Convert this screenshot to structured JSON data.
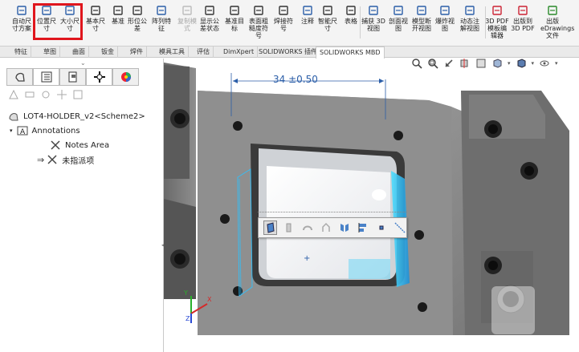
{
  "ribbon": {
    "buttons": [
      {
        "label": "自动尺\n寸方案",
        "icon": "auto-dimension-icon",
        "state": "enabled"
      },
      {
        "label": "位置尺\n寸",
        "icon": "location-dimension-icon",
        "state": "enabled"
      },
      {
        "label": "大小尺\n寸",
        "icon": "size-dimension-icon",
        "state": "enabled"
      },
      {
        "label": "基本尺\n寸",
        "icon": "basic-dimension-icon",
        "state": "enabled"
      },
      {
        "label": "基准",
        "icon": "datum-icon",
        "state": "enabled"
      },
      {
        "label": "形位公\n差",
        "icon": "geometric-tolerance-icon",
        "state": "enabled"
      },
      {
        "label": "阵列特\n征",
        "icon": "pattern-feature-icon",
        "state": "enabled"
      },
      {
        "label": "复制模\n式",
        "icon": "copy-scheme-icon",
        "state": "disabled"
      },
      {
        "label": "显示公\n差状态",
        "icon": "tolerance-status-icon",
        "state": "enabled"
      },
      {
        "label": "基准目\n标",
        "icon": "datum-target-icon",
        "state": "enabled"
      },
      {
        "label": "表面粗\n糙度符\n号",
        "icon": "surface-finish-icon",
        "state": "enabled"
      },
      {
        "label": "焊接符\n号",
        "icon": "weld-symbol-icon",
        "state": "enabled"
      },
      {
        "label": "注释",
        "icon": "note-icon",
        "state": "enabled"
      },
      {
        "label": "智能尺\n寸",
        "icon": "smart-dimension-icon",
        "state": "enabled"
      },
      {
        "label": "表格",
        "icon": "table-icon",
        "state": "enabled"
      },
      {
        "label": "捕获 3D\n视图",
        "icon": "capture-3d-view-icon",
        "state": "enabled"
      },
      {
        "label": "剖面视\n图",
        "icon": "section-view-icon",
        "state": "enabled"
      },
      {
        "label": "模型断\n开视图",
        "icon": "model-break-view-icon",
        "state": "enabled"
      },
      {
        "label": "爆炸视\n图",
        "icon": "exploded-view-icon",
        "state": "enabled"
      },
      {
        "label": "动态注\n解视图",
        "icon": "dynamic-annotation-views-icon",
        "state": "enabled"
      },
      {
        "label": "3D PDF\n模板编\n辑器",
        "icon": "3d-pdf-template-editor-icon",
        "state": "enabled"
      },
      {
        "label": "出版到\n3D PDF",
        "icon": "publish-3d-pdf-icon",
        "state": "enabled"
      },
      {
        "label": "出版\neDrawings\n文件",
        "icon": "publish-edrawings-icon",
        "state": "enabled"
      }
    ]
  },
  "tabs": [
    "特征",
    "草图",
    "曲面",
    "钣金",
    "焊件",
    "模具工具",
    "评估",
    "DimXpert",
    "SOLIDWORKS 插件",
    "SOLIDWORKS MBD"
  ],
  "active_tab": "SOLIDWORKS MBD",
  "feature_manager": {
    "tab_icons": [
      "feature-manager-icon",
      "property-manager-icon",
      "configuration-manager-icon",
      "dimxpert-manager-icon",
      "display-manager-icon"
    ],
    "tree": {
      "root": "LOT4-HOLDER_v2<Scheme2>",
      "annotations_label": "Annotations",
      "notes_area": "Notes Area",
      "unassigned": "未指派项"
    }
  },
  "viewport": {
    "dimension_label": "34 ±0.50",
    "axis_labels": {
      "x": "X",
      "y": "Y",
      "z": "Z"
    }
  },
  "colors": {
    "highlight": "#e0161d",
    "selection": "#2cc2ff",
    "part_gray": "#8c8c8c"
  }
}
